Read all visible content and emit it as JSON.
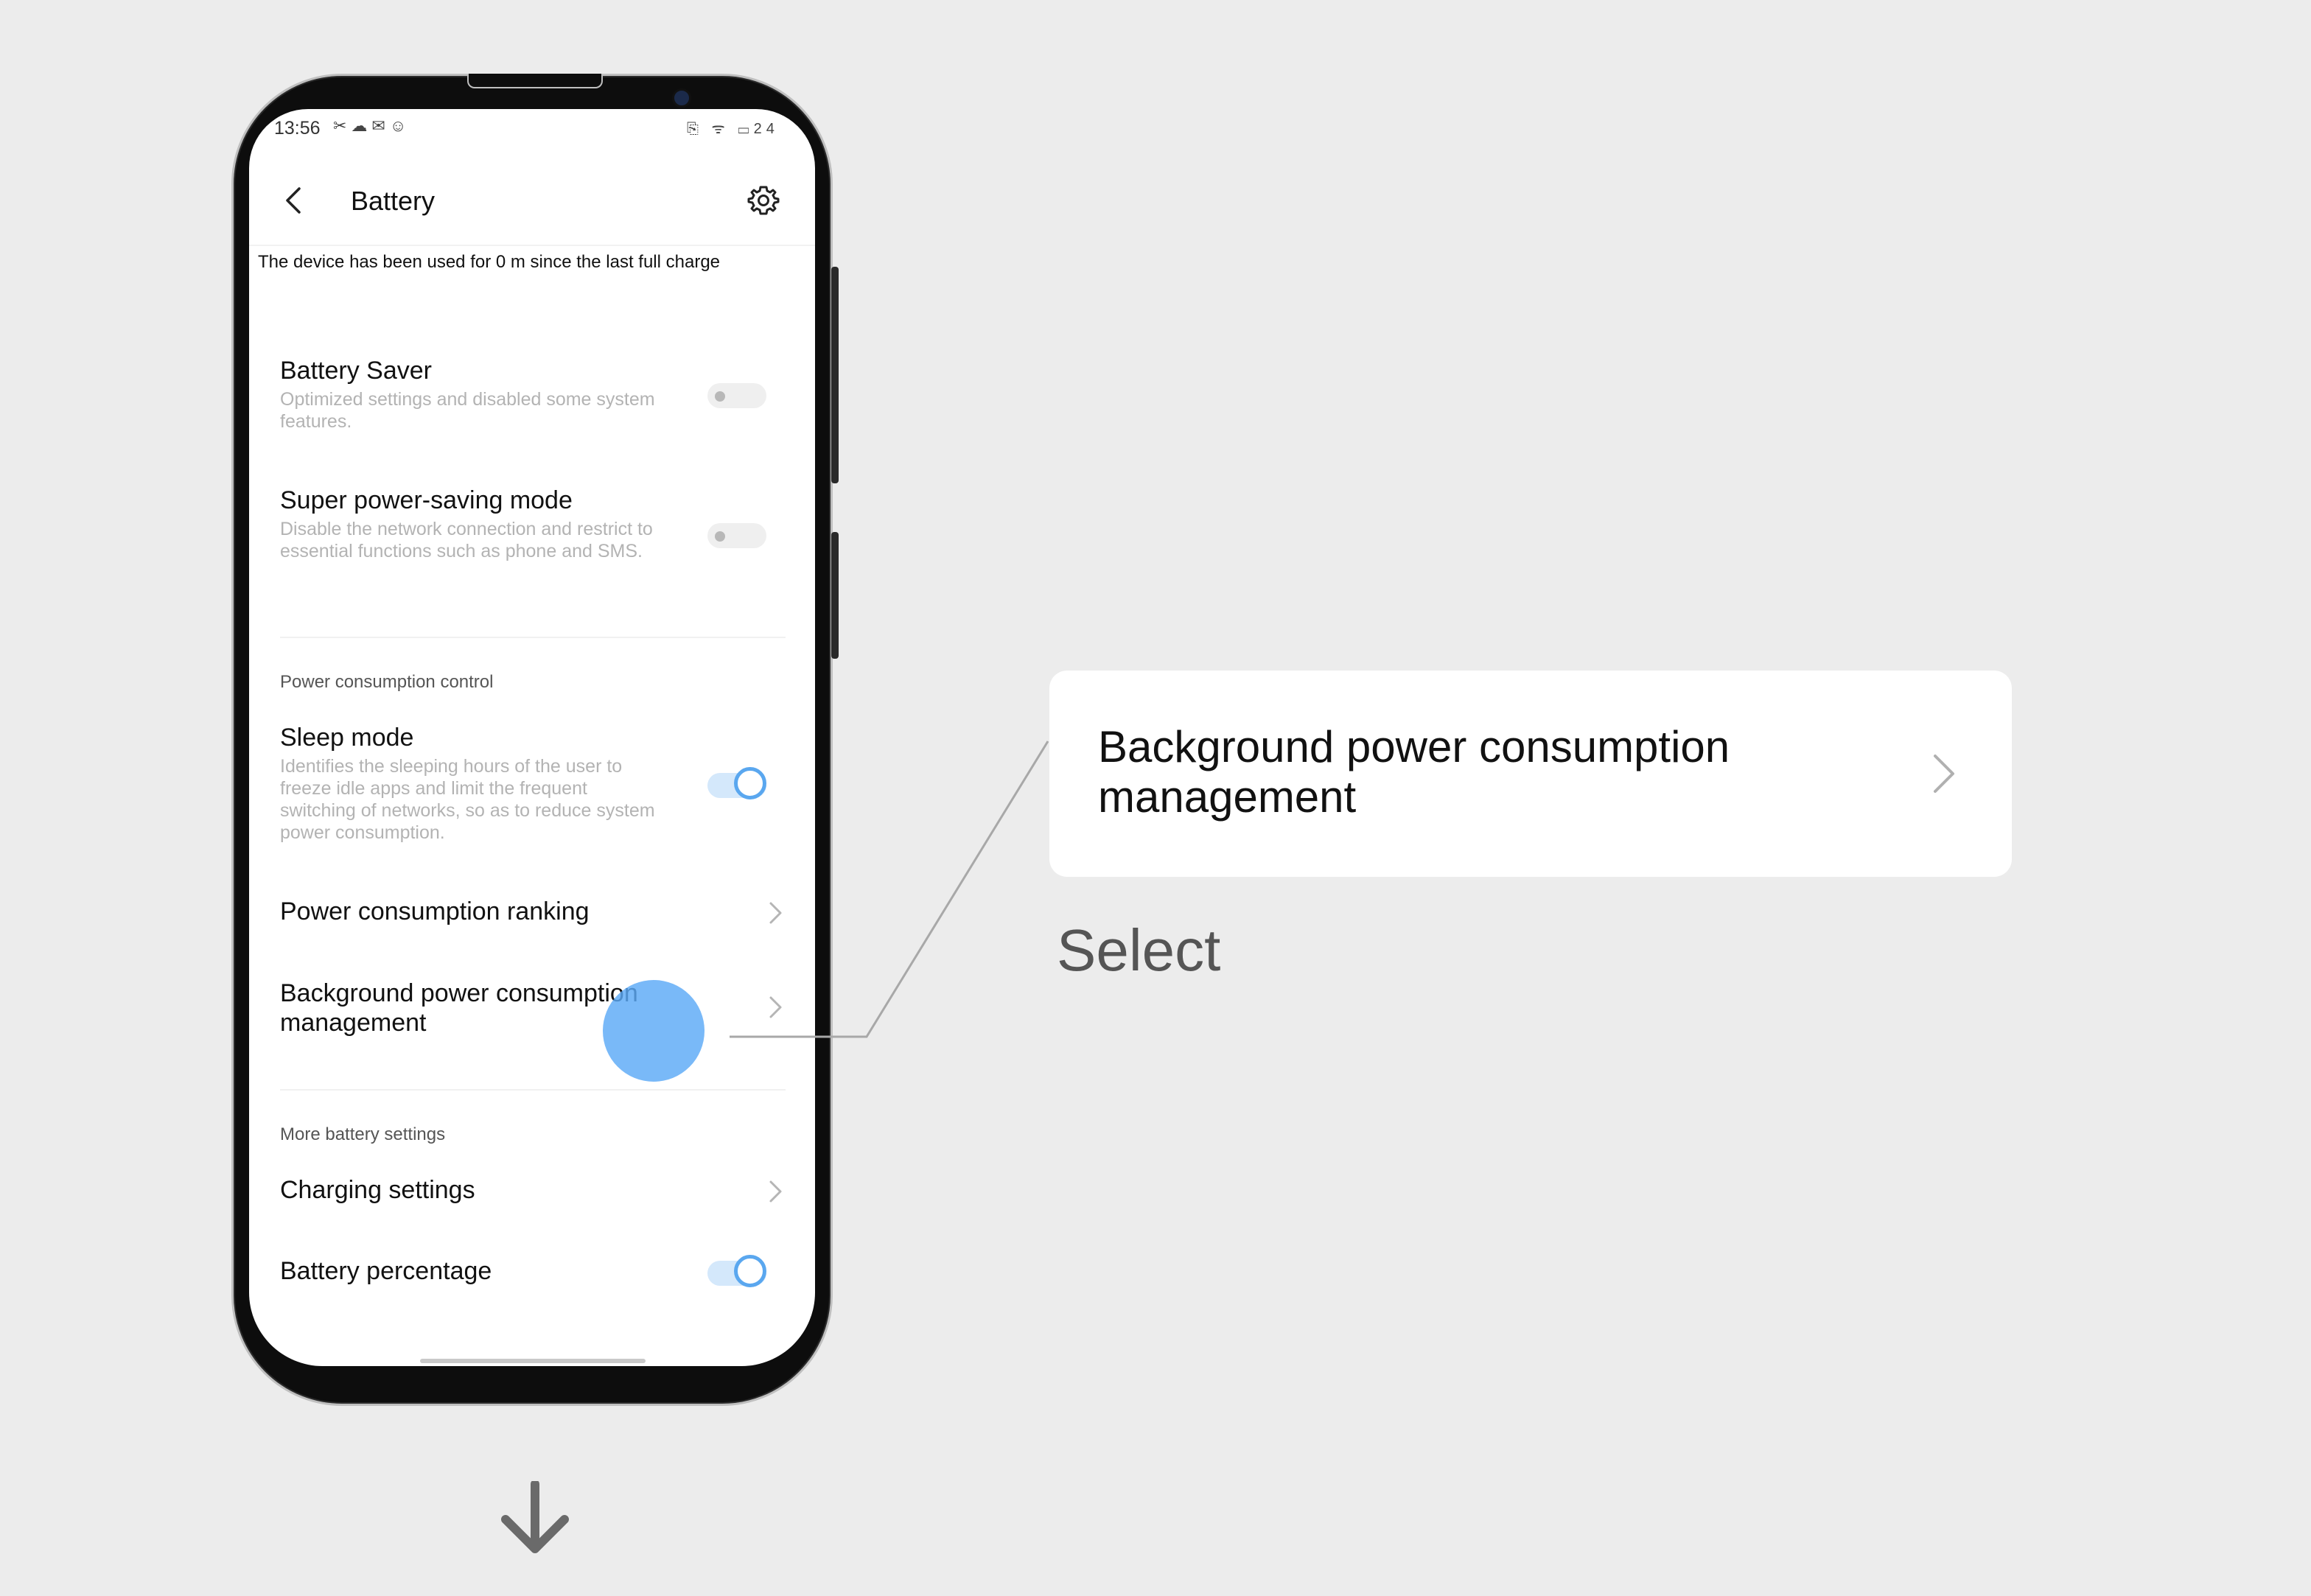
{
  "status_bar": {
    "time": "13:56",
    "left_icons": "✂☁✉☺",
    "right_icons": "⎘ ᯤ ▭24"
  },
  "header": {
    "title": "Battery"
  },
  "usage_text": "The device has been used for 0 m since the last full charge",
  "items": {
    "battery_saver": {
      "title": "Battery Saver",
      "desc": "Optimized settings and disabled some system features.",
      "enabled": false
    },
    "super_saving": {
      "title": "Super power-saving mode",
      "desc": "Disable the network connection and restrict to essential functions such as phone and SMS.",
      "enabled": false
    },
    "sleep_mode": {
      "title": "Sleep mode",
      "desc": "Identifies the sleeping hours of the user to freeze idle apps and limit the frequent switching of networks, so as to reduce system power consumption.",
      "enabled": true
    },
    "ranking": {
      "title": "Power consumption ranking"
    },
    "background": {
      "title": "Background power consumption management"
    },
    "charging": {
      "title": "Charging settings"
    },
    "percentage": {
      "title": "Battery percentage",
      "enabled": true
    }
  },
  "sections": {
    "control": "Power consumption control",
    "more": "More battery settings"
  },
  "callout": {
    "text": "Background power consumption management",
    "action": "Select"
  },
  "colors": {
    "accent": "#5aa7ef",
    "tap_marker": "#5caaf7",
    "background": "#ececec"
  }
}
